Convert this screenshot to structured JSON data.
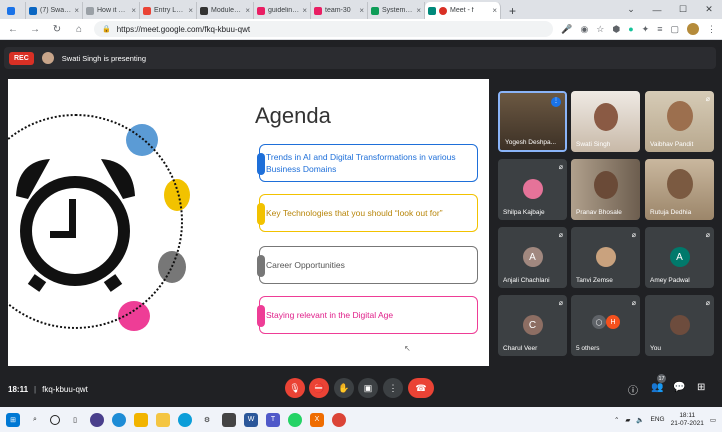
{
  "tabs": [
    {
      "label": "",
      "color": "#1a73e8"
    },
    {
      "label": "(7) Swati Sing",
      "color": "#0a66c2"
    },
    {
      "label": "How it Works",
      "color": "#9aa0a6"
    },
    {
      "label": "Entry Level",
      "color": "#ea4335"
    },
    {
      "label": "Module 1: Pr",
      "color": "#333333"
    },
    {
      "label": "guidelines",
      "color": "#e91e63"
    },
    {
      "label": "team-30",
      "color": "#e91e63"
    },
    {
      "label": "Systems Tran",
      "color": "#0f9d58"
    },
    {
      "label": "Meet - f",
      "color": "#00897b"
    }
  ],
  "address": {
    "url": "https://meet.google.com/fkq-kbuu-qwt"
  },
  "presenting": {
    "rec_label": "REC",
    "text": "Swati Singh is presenting"
  },
  "slide": {
    "title": "Agenda",
    "items": [
      {
        "text": "Trends in AI and Digital Transformations in various Business Domains",
        "color": "#1e6fd9",
        "border": "#1e6fd9"
      },
      {
        "text": "Key Technologies that you should “look out for”",
        "color": "#b8860b",
        "border": "#f2c200"
      },
      {
        "text": "Career Opportunities",
        "color": "#555555",
        "border": "#777777"
      },
      {
        "text": "Staying relevant in the Digital Age",
        "color": "#e0208a",
        "border": "#ee3d96"
      }
    ]
  },
  "participants": [
    {
      "name": "Yogesh Deshpa...",
      "initial": "",
      "color": "#5a4a3a"
    },
    {
      "name": "Swati Singh",
      "initial": "",
      "color": "#e6e1dc"
    },
    {
      "name": "Vaibhav Pandit",
      "initial": "",
      "color": "#ccbfa8"
    },
    {
      "name": "Shilpa Kajbaje",
      "initial": "",
      "color": "#3c4043"
    },
    {
      "name": "Pranav Bhosale",
      "initial": "",
      "color": "#8f7c6a"
    },
    {
      "name": "Rutuja Dedhia",
      "initial": "",
      "color": "#b9a68f"
    },
    {
      "name": "Anjali Chachlani",
      "initial": "A",
      "color": "#a1887f"
    },
    {
      "name": "Tanvi Zemse",
      "initial": "",
      "color": "#3c4043"
    },
    {
      "name": "Amey Padwal",
      "initial": "A",
      "color": "#00796b"
    },
    {
      "name": "Charul Veer",
      "initial": "C",
      "color": "#8d6e63"
    },
    {
      "name": "5 others",
      "initial": "H",
      "color": "#3c4043"
    },
    {
      "name": "You",
      "initial": "",
      "color": "#3c4043"
    }
  ],
  "bottom": {
    "time": "18:11",
    "sep": "|",
    "code": "fkq-kbuu-qwt",
    "people_count": "17"
  },
  "taskbar": {
    "lang": "ENG",
    "time": "18:11",
    "date": "21-07-2021"
  }
}
